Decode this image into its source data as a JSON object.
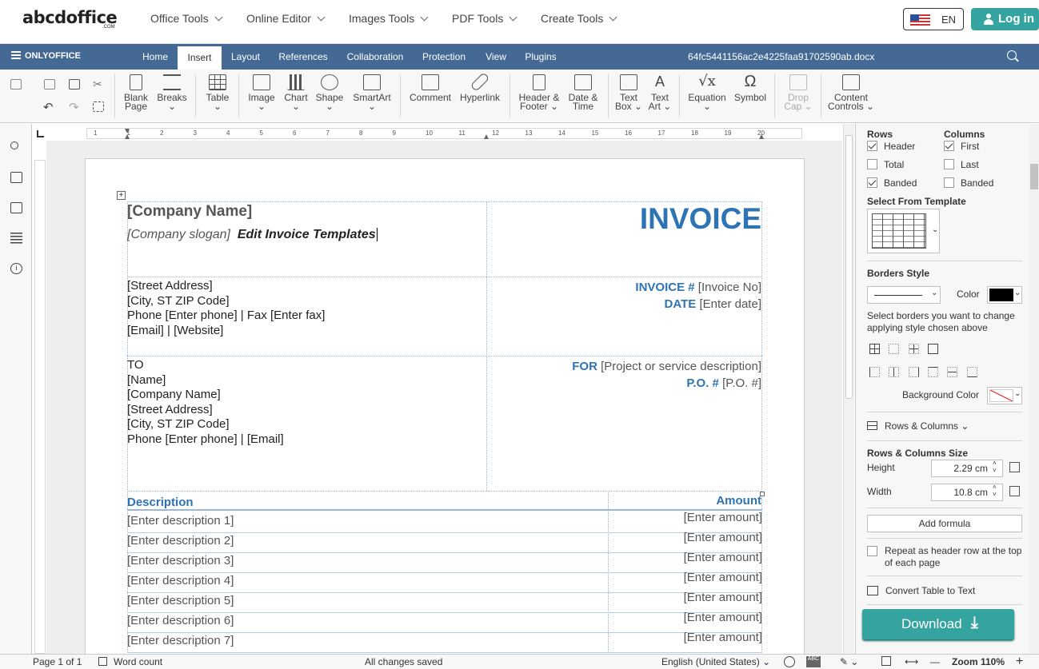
{
  "site": {
    "logo": "abcdoffice",
    "logo_sub": ".COM",
    "nav": [
      "Office Tools",
      "Online Editor",
      "Images Tools",
      "PDF Tools",
      "Create Tools"
    ],
    "lang": "EN",
    "login": "Log in"
  },
  "editor": {
    "brand": "ONLYOFFICE",
    "tabs": [
      "Home",
      "Insert",
      "Layout",
      "References",
      "Collaboration",
      "Protection",
      "View",
      "Plugins"
    ],
    "active_tab": "Insert",
    "doc_name": "64fc5441156ac2e4225faa91702590ab.docx"
  },
  "toolbar": {
    "blank_page": [
      "Blank",
      "Page"
    ],
    "breaks": "Breaks",
    "table": "Table",
    "image": "Image",
    "chart": "Chart",
    "shape": "Shape",
    "smartart": "SmartArt",
    "comment": "Comment",
    "hyperlink": "Hyperlink",
    "header_footer": [
      "Header &",
      "Footer"
    ],
    "date_time": [
      "Date &",
      "Time"
    ],
    "text_box": [
      "Text",
      "Box"
    ],
    "text_art": [
      "Text",
      "Art"
    ],
    "equation": "Equation",
    "symbol": "Symbol",
    "drop_cap": [
      "Drop",
      "Cap"
    ],
    "content_controls": [
      "Content",
      "Controls"
    ]
  },
  "ruler": {
    "numbers": [
      "1",
      "1",
      "2",
      "3",
      "4",
      "5",
      "6",
      "7",
      "8",
      "9",
      "10",
      "11",
      "12",
      "13",
      "14",
      "15",
      "16",
      "17",
      "18",
      "19",
      "20"
    ]
  },
  "document": {
    "company_name": "[Company Name]",
    "company_slogan": "[Company slogan]",
    "edit_text": "Edit Invoice Templates",
    "invoice_title": "INVOICE",
    "address_lines": [
      "[Street Address]",
      "[City, ST ZIP Code]",
      "Phone [Enter phone] | Fax [Enter fax]",
      "[Email] | [Website]"
    ],
    "invoice_no_label": "INVOICE #",
    "invoice_no_value": "[Invoice No]",
    "date_label": "DATE",
    "date_value": "[Enter date]",
    "to_lines": [
      "TO",
      "[Name]",
      "[Company Name]",
      "[Street Address]",
      "[City, ST ZIP Code]",
      "Phone [Enter phone] | [Email]"
    ],
    "for_label": "FOR",
    "for_value": "[Project or service description]",
    "po_label": "P.O. #",
    "po_value": "[P.O. #]",
    "table_header": {
      "description": "Description",
      "amount": "Amount"
    },
    "rows": [
      {
        "description": "[Enter description 1]",
        "amount": "[Enter amount]"
      },
      {
        "description": "[Enter description 2]",
        "amount": "[Enter amount]"
      },
      {
        "description": "[Enter description 3]",
        "amount": "[Enter amount]"
      },
      {
        "description": "[Enter description 4]",
        "amount": "[Enter amount]"
      },
      {
        "description": "[Enter description 5]",
        "amount": "[Enter amount]"
      },
      {
        "description": "[Enter description 6]",
        "amount": "[Enter amount]"
      },
      {
        "description": "[Enter description 7]",
        "amount": "[Enter amount]"
      }
    ]
  },
  "panel": {
    "rows_title": "Rows",
    "columns_title": "Columns",
    "header": "Header",
    "total": "Total",
    "banded": "Banded",
    "first": "First",
    "last": "Last",
    "banded_col": "Banded",
    "select_template": "Select From Template",
    "borders_style": "Borders Style",
    "color": "Color",
    "borders_hint": [
      "Select borders you want to change",
      "applying style chosen above"
    ],
    "background_color": "Background Color",
    "rows_columns": "Rows & Columns",
    "size_title": "Rows & Columns Size",
    "height_label": "Height",
    "height_value": "2.29 cm",
    "width_label": "Width",
    "width_value": "10.8 cm",
    "add_formula": "Add formula",
    "repeat_header": [
      "Repeat as header row at the top",
      "of each page"
    ],
    "convert": "Convert Table to Text",
    "download": "Download",
    "checks": {
      "header": true,
      "total": false,
      "banded": true,
      "first": true,
      "last": false,
      "banded_col": false,
      "repeat": false
    },
    "border_color": "#000000"
  },
  "status": {
    "page": "Page 1 of 1",
    "word_count": "Word count",
    "saved": "All changes saved",
    "language": "English (United States)",
    "zoom": "Zoom 110%"
  }
}
